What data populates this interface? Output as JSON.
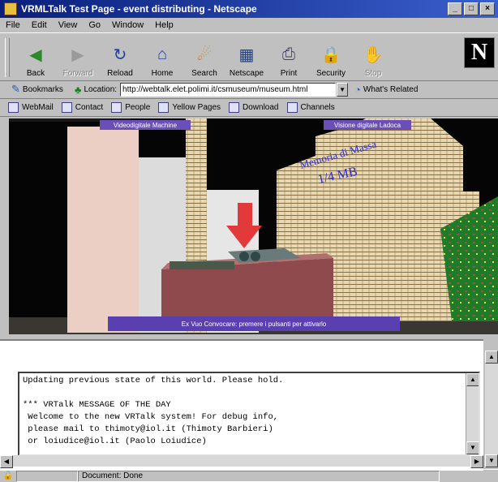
{
  "window": {
    "title": "VRMLTalk Test Page - event distributing - Netscape",
    "min": "_",
    "max": "□",
    "close": "×"
  },
  "menu": [
    "File",
    "Edit",
    "View",
    "Go",
    "Window",
    "Help"
  ],
  "toolbar": {
    "buttons": [
      {
        "label": "Back",
        "icon": "back-arrow-icon",
        "glyph": "◀",
        "color": "#2a8a2a",
        "enabled": true
      },
      {
        "label": "Forward",
        "icon": "forward-arrow-icon",
        "glyph": "▶",
        "color": "#9a9a9a",
        "enabled": false
      },
      {
        "label": "Reload",
        "icon": "reload-icon",
        "glyph": "↻",
        "color": "#2040a0",
        "enabled": true
      },
      {
        "label": "Home",
        "icon": "home-icon",
        "glyph": "⌂",
        "color": "#2040a0",
        "enabled": true
      },
      {
        "label": "Search",
        "icon": "search-icon",
        "glyph": "☄",
        "color": "#c08020",
        "enabled": true
      },
      {
        "label": "Netscape",
        "icon": "netscape-icon",
        "glyph": "▦",
        "color": "#204080",
        "enabled": true
      },
      {
        "label": "Print",
        "icon": "print-icon",
        "glyph": "⎙",
        "color": "#404060",
        "enabled": true
      },
      {
        "label": "Security",
        "icon": "security-lock-icon",
        "glyph": "🔒",
        "color": "#a04040",
        "enabled": true
      },
      {
        "label": "Stop",
        "icon": "stop-icon",
        "glyph": "✋",
        "color": "#9a9a9a",
        "enabled": false
      }
    ],
    "logo": "N"
  },
  "location": {
    "bookmarks_label": "Bookmarks",
    "location_label": "Location:",
    "url": "http://webtalk.elet.polimi.it/csmuseum/museum.html",
    "related_label": "What's Related"
  },
  "personal": [
    "WebMail",
    "Contact",
    "People",
    "Yellow Pages",
    "Download",
    "Channels"
  ],
  "scene": {
    "label_left": "Videodigitale Machine",
    "label_right": "Visione digitale Ladoca",
    "wall_text_1": "Memoria di Massa",
    "wall_text_2": "1/4 MB",
    "bottom_label": "Ex Vuo Convocare: premere i pulsanti per attivarlo"
  },
  "message_lines": [
    "Updating previous state of this world. Please hold.",
    "",
    "*** VRTalk MESSAGE OF THE DAY",
    " Welcome to the new VRTalk system! For debug info,",
    " please mail to thimoty@iol.it (Thimoty Barbieri)",
    " or loiudice@iol.it (Paolo Loiudice)"
  ],
  "status": {
    "text": "Document: Done"
  }
}
